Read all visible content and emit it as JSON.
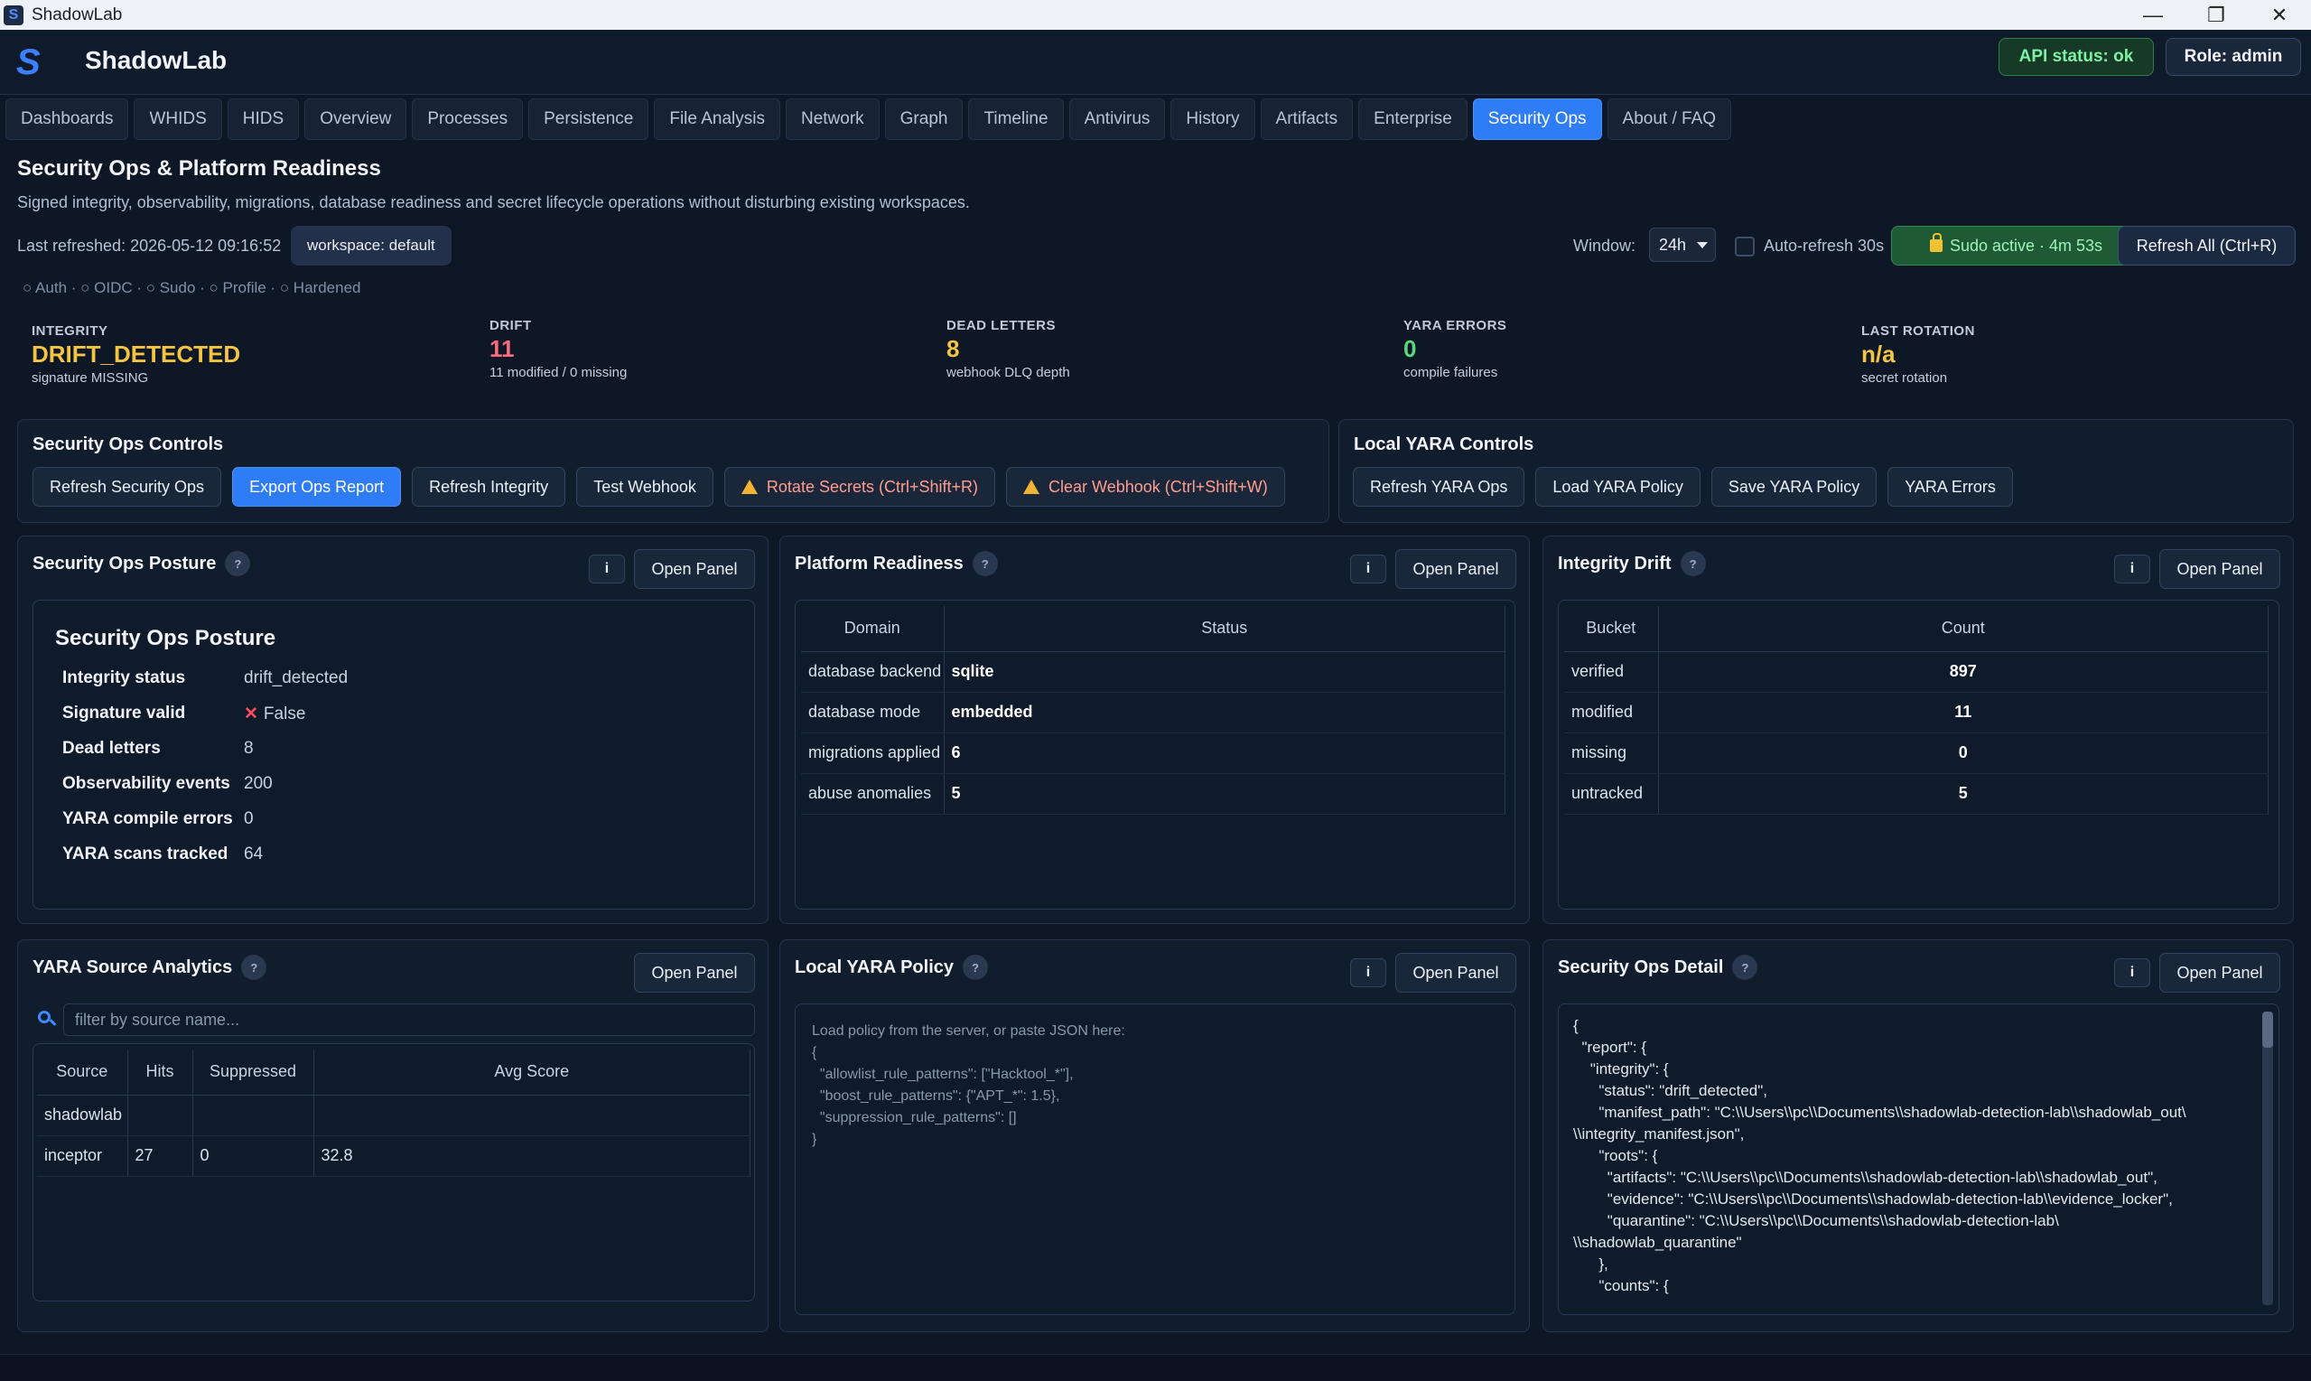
{
  "window": {
    "title": "ShadowLab",
    "controls": [
      "—",
      "❐",
      "✕"
    ]
  },
  "header": {
    "logo": "S",
    "brand": "ShadowLab",
    "api_status": "API status: ok",
    "role": "Role: admin"
  },
  "tabs": [
    "Dashboards",
    "WHIDS",
    "HIDS",
    "Overview",
    "Processes",
    "Persistence",
    "File Analysis",
    "Network",
    "Graph",
    "Timeline",
    "Antivirus",
    "History",
    "Artifacts",
    "Enterprise",
    "Security Ops",
    "About / FAQ"
  ],
  "active_tab": "Security Ops",
  "page": {
    "title": "Security Ops & Platform Readiness",
    "subtitle": "Signed integrity, observability, migrations, database readiness and secret lifecycle operations without disturbing existing workspaces.",
    "last_refreshed": "Last refreshed: 2026-05-12 09:16:52",
    "workspace": "workspace: default",
    "window_label": "Window:",
    "window_value": "24h",
    "auto_refresh": "Auto-refresh 30s",
    "sudo": "Sudo active · 4m 53s",
    "refresh_all": "Refresh All (Ctrl+R)",
    "auth_line": "○ Auth · ○ OIDC · ○ Sudo · ○ Profile · ○ Hardened"
  },
  "kpis": {
    "integrity": {
      "label": "INTEGRITY",
      "value": "DRIFT_DETECTED",
      "sub": "signature MISSING",
      "color": "#f5c542"
    },
    "drift": {
      "label": "DRIFT",
      "value": "11",
      "sub": "11 modified / 0 missing",
      "color": "#ff6b7a"
    },
    "dead_letters": {
      "label": "DEAD LETTERS",
      "value": "8",
      "sub": "webhook DLQ depth",
      "color": "#f5c542"
    },
    "yara_errors": {
      "label": "YARA ERRORS",
      "value": "0",
      "sub": "compile failures",
      "color": "#59d97c"
    },
    "last_rotation": {
      "label": "LAST ROTATION",
      "value": "n/a",
      "sub": "secret rotation",
      "color": "#f5c542"
    }
  },
  "controls": {
    "title": "Security Ops Controls",
    "buttons": [
      "Refresh Security Ops",
      "Export Ops Report",
      "Refresh Integrity",
      "Test Webhook",
      "Rotate Secrets (Ctrl+Shift+R)",
      "Clear Webhook (Ctrl+Shift+W)"
    ]
  },
  "yara_controls": {
    "title": "Local YARA Controls",
    "buttons": [
      "Refresh YARA Ops",
      "Load YARA Policy",
      "Save YARA Policy",
      "YARA Errors"
    ]
  },
  "panels": {
    "info_button": "i",
    "open_button": "Open Panel",
    "help": "?"
  },
  "posture": {
    "title": "Security Ops Posture",
    "inner_title": "Security Ops Posture",
    "rows": [
      {
        "k": "Integrity status",
        "v": "drift_detected"
      },
      {
        "k": "Signature valid",
        "v": "False"
      },
      {
        "k": "Dead letters",
        "v": "8"
      },
      {
        "k": "Observability events",
        "v": "200"
      },
      {
        "k": "YARA compile errors",
        "v": "0"
      },
      {
        "k": "YARA scans tracked",
        "v": "64"
      }
    ]
  },
  "readiness": {
    "title": "Platform Readiness",
    "headers": [
      "Domain",
      "Status"
    ],
    "rows": [
      [
        "database backend",
        "sqlite"
      ],
      [
        "database mode",
        "embedded"
      ],
      [
        "migrations applied",
        "6"
      ],
      [
        "abuse anomalies",
        "5"
      ]
    ]
  },
  "drift": {
    "title": "Integrity Drift",
    "headers": [
      "Bucket",
      "Count"
    ],
    "rows": [
      [
        "verified",
        "897"
      ],
      [
        "modified",
        "11"
      ],
      [
        "missing",
        "0"
      ],
      [
        "untracked",
        "5"
      ]
    ]
  },
  "yara_sources": {
    "title": "YARA Source Analytics",
    "filter_placeholder": "filter by source name...",
    "headers": [
      "Source",
      "Hits",
      "Suppressed",
      "Avg Score"
    ],
    "rows": [
      [
        "shadowlab",
        "",
        "",
        ""
      ],
      [
        "inceptor",
        "27",
        "0",
        "32.8"
      ]
    ]
  },
  "yara_policy": {
    "title": "Local YARA Policy",
    "placeholder": "Load policy from the server, or paste JSON here:\n{\n  \"allowlist_rule_patterns\": [\"Hacktool_*\"],\n  \"boost_rule_patterns\": {\"APT_*\": 1.5},\n  \"suppression_rule_patterns\": []\n}"
  },
  "detail": {
    "title": "Security Ops Detail",
    "json": "{\n  \"report\": {\n    \"integrity\": {\n      \"status\": \"drift_detected\",\n      \"manifest_path\": \"C:\\\\Users\\\\pc\\\\Documents\\\\shadowlab-detection-lab\\\\shadowlab_out\\\n\\\\integrity_manifest.json\",\n      \"roots\": {\n        \"artifacts\": \"C:\\\\Users\\\\pc\\\\Documents\\\\shadowlab-detection-lab\\\\shadowlab_out\",\n        \"evidence\": \"C:\\\\Users\\\\pc\\\\Documents\\\\shadowlab-detection-lab\\\\evidence_locker\",\n        \"quarantine\": \"C:\\\\Users\\\\pc\\\\Documents\\\\shadowlab-detection-lab\\\n\\\\shadowlab_quarantine\"\n      },\n      \"counts\": {"
  }
}
